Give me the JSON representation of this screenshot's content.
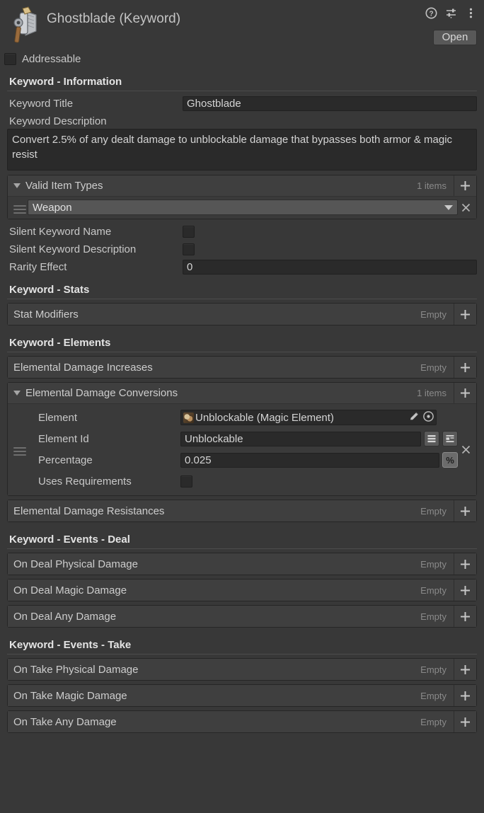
{
  "header": {
    "title": "Ghostblade (Keyword)",
    "icon": "weapon-axe-icon",
    "help_icon": "help-icon",
    "preset_icon": "preset-settings-icon",
    "menu_icon": "kebab-menu-icon",
    "open_label": "Open"
  },
  "addressable": {
    "label": "Addressable",
    "checked": false
  },
  "sections": {
    "information": {
      "title": "Keyword - Information",
      "keyword_title_label": "Keyword Title",
      "keyword_title_value": "Ghostblade",
      "keyword_description_label": "Keyword Description",
      "keyword_description_value": "Convert 2.5% of any dealt damage to unblockable damage that bypasses both armor & magic resist",
      "valid_item_types": {
        "label": "Valid Item Types",
        "count": "1 items",
        "expanded": true,
        "items": [
          {
            "value": "Weapon"
          }
        ]
      },
      "silent_keyword_name_label": "Silent Keyword Name",
      "silent_keyword_name_checked": false,
      "silent_keyword_description_label": "Silent Keyword Description",
      "silent_keyword_description_checked": false,
      "rarity_effect_label": "Rarity Effect",
      "rarity_effect_value": "0"
    },
    "stats": {
      "title": "Keyword - Stats",
      "stat_modifiers": {
        "label": "Stat Modifiers",
        "count": "Empty"
      }
    },
    "elements": {
      "title": "Keyword - Elements",
      "damage_increases": {
        "label": "Elemental Damage Increases",
        "count": "Empty"
      },
      "damage_conversions": {
        "label": "Elemental Damage Conversions",
        "count": "1 items",
        "item": {
          "element_label": "Element",
          "element_value": "Unblockable (Magic Element)",
          "element_id_label": "Element Id",
          "element_id_value": "Unblockable",
          "percentage_label": "Percentage",
          "percentage_value": "0.025",
          "percentage_toggle": "%",
          "uses_requirements_label": "Uses Requirements",
          "uses_requirements_checked": false
        }
      },
      "damage_resistances": {
        "label": "Elemental Damage Resistances",
        "count": "Empty"
      }
    },
    "events_deal": {
      "title": "Keyword - Events - Deal",
      "rows": [
        {
          "label": "On Deal Physical Damage",
          "count": "Empty"
        },
        {
          "label": "On Deal Magic Damage",
          "count": "Empty"
        },
        {
          "label": "On Deal Any Damage",
          "count": "Empty"
        }
      ]
    },
    "events_take": {
      "title": "Keyword - Events - Take",
      "rows": [
        {
          "label": "On Take Physical Damage",
          "count": "Empty"
        },
        {
          "label": "On Take Magic Damage",
          "count": "Empty"
        },
        {
          "label": "On Take Any Damage",
          "count": "Empty"
        }
      ]
    }
  },
  "colors": {
    "window_bg": "#383838",
    "list_bg": "#3a3a3a",
    "input_bg": "#2a2a2a",
    "text": "#c8c8c8",
    "muted": "#8a8a8a",
    "accent_button": "#585858"
  }
}
